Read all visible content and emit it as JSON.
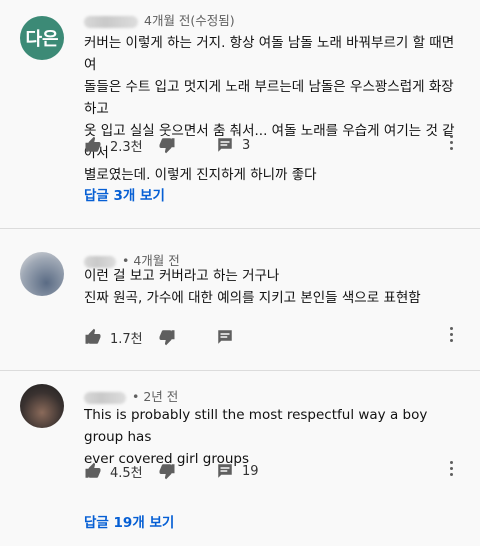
{
  "colors": {
    "accent": "#065fd4",
    "avatar1": "#3c8a76"
  },
  "comments": [
    {
      "avatar_text": "다은",
      "meta": "4개월 전(수정됨)",
      "text": "커버는 이렇게 하는 거지. 항상 여돌 남돌 노래 바꿔부르기 할 때면 여\n돌들은 수트 입고 멋지게 노래 부르는데 남돌은 우스꽝스럽게 화장하고\n옷 입고 실실 웃으면서 춤 춰서... 여돌 노래를 우습게 여기는 것 같아서\n별로였는데. 이렇게 진지하게 하니까 좋다",
      "likes": "2.3천",
      "reply_count": "3",
      "replies_link": "답글 3개 보기"
    },
    {
      "meta": "• 4개월 전",
      "text": "이런 걸 보고 커버라고 하는 거구나\n진짜 원곡, 가수에 대한 예의를 지키고 본인들 색으로 표현함",
      "likes": "1.7천"
    },
    {
      "meta": "• 2년 전",
      "text": "This is probably still the most respectful way a boy group has\never covered girl groups",
      "likes": "4.5천",
      "reply_count": "19",
      "replies_link": "답글 19개 보기"
    }
  ],
  "icons": [
    "like-icon",
    "dislike-icon",
    "comment-icon",
    "more-icon"
  ]
}
